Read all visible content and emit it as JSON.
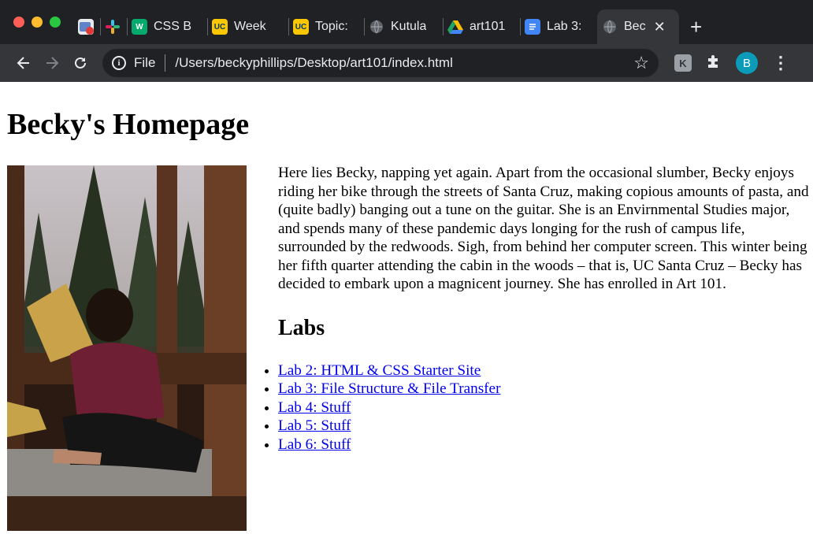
{
  "browser": {
    "tabs": [
      {
        "label": "",
        "icon": "app-icon"
      },
      {
        "label": "",
        "icon": "slack-icon"
      },
      {
        "label": "CSS B",
        "icon": "w3schools-icon"
      },
      {
        "label": "Week",
        "icon": "ucsc-icon"
      },
      {
        "label": "Topic:",
        "icon": "ucsc-icon"
      },
      {
        "label": "Kutula",
        "icon": "globe-icon"
      },
      {
        "label": "art101",
        "icon": "drive-icon"
      },
      {
        "label": "Lab 3:",
        "icon": "docs-icon"
      },
      {
        "label": "Bec",
        "icon": "globe-icon",
        "active": true
      }
    ],
    "new_tab": "+",
    "close": "✕",
    "address": {
      "scheme_label": "File",
      "url": "/Users/beckyphillips/Desktop/art101/index.html"
    },
    "ext_label": "K",
    "profile_initial": "B"
  },
  "page": {
    "title": "Becky's Homepage",
    "bio": "Here lies Becky, napping yet again. Apart from the occasional slumber, Becky enjoys riding her bike through the streets of Santa Cruz, making copious amounts of pasta, and (quite badly) banging out a tune on the guitar. She is an Envirnmental Studies major, and spends many of these pandemic days longing for the rush of campus life, surrounded by the redwoods. Sigh, from behind her computer screen. This winter being her fifth quarter attending the cabin in the woods – that is, UC Santa Cruz – Becky has decided to embark upon a magnicent journey. She has enrolled in Art 101.",
    "labs_heading": "Labs",
    "labs": [
      "Lab 2: HTML & CSS Starter Site",
      "Lab 3: File Structure & File Transfer",
      "Lab 4: Stuff",
      "Lab 5: Stuff",
      "Lab 6: Stuff"
    ]
  },
  "colors": {
    "chrome_dark": "#202124",
    "chrome_toolbar": "#35363a",
    "link": "#0000ee",
    "close_dot": "#ff5f57",
    "min_dot": "#febc2e",
    "max_dot": "#28c840"
  }
}
